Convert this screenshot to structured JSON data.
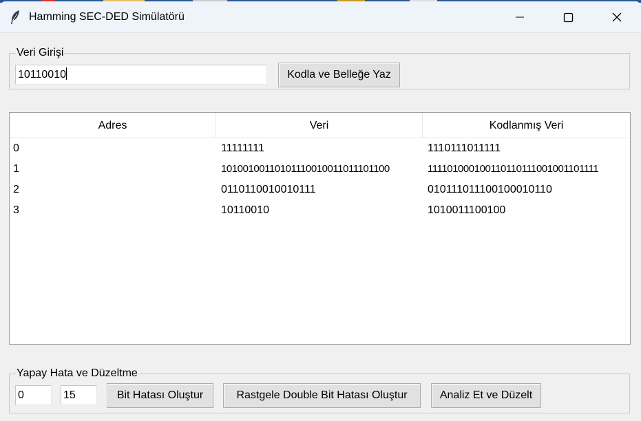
{
  "window": {
    "title": "Hamming SEC-DED Simülatörü"
  },
  "input_group": {
    "legend": "Veri Girişi",
    "data_value": "10110010",
    "encode_button": "Kodla ve Belleğe Yaz"
  },
  "table": {
    "columns": [
      "Adres",
      "Veri",
      "Kodlanmış Veri"
    ],
    "rows": [
      {
        "address": "0",
        "data": "11111111",
        "encoded": "1110111011111"
      },
      {
        "address": "1",
        "data": "10100100110101110010011011101100",
        "encoded": "111101000100110110111001001101111"
      },
      {
        "address": "2",
        "data": "0110110010010111",
        "encoded": "010111011100100010110"
      },
      {
        "address": "3",
        "data": "10110010",
        "encoded": "1010011100100"
      }
    ]
  },
  "error_group": {
    "legend": "Yapay Hata ve Düzeltme",
    "address_value": "0",
    "bit_value": "15",
    "bit_error_button": "Bit Hatası Oluştur",
    "double_error_button": "Rastgele Double Bit Hatası Oluştur",
    "analyze_button": "Analiz Et ve Düzelt"
  },
  "colors": {
    "titlebar": "#eef4f9",
    "window_bg": "#f0f0f0",
    "button_bg": "#e1e1e1"
  },
  "icons": [
    "feather-icon",
    "minimize-icon",
    "maximize-icon",
    "close-icon"
  ]
}
